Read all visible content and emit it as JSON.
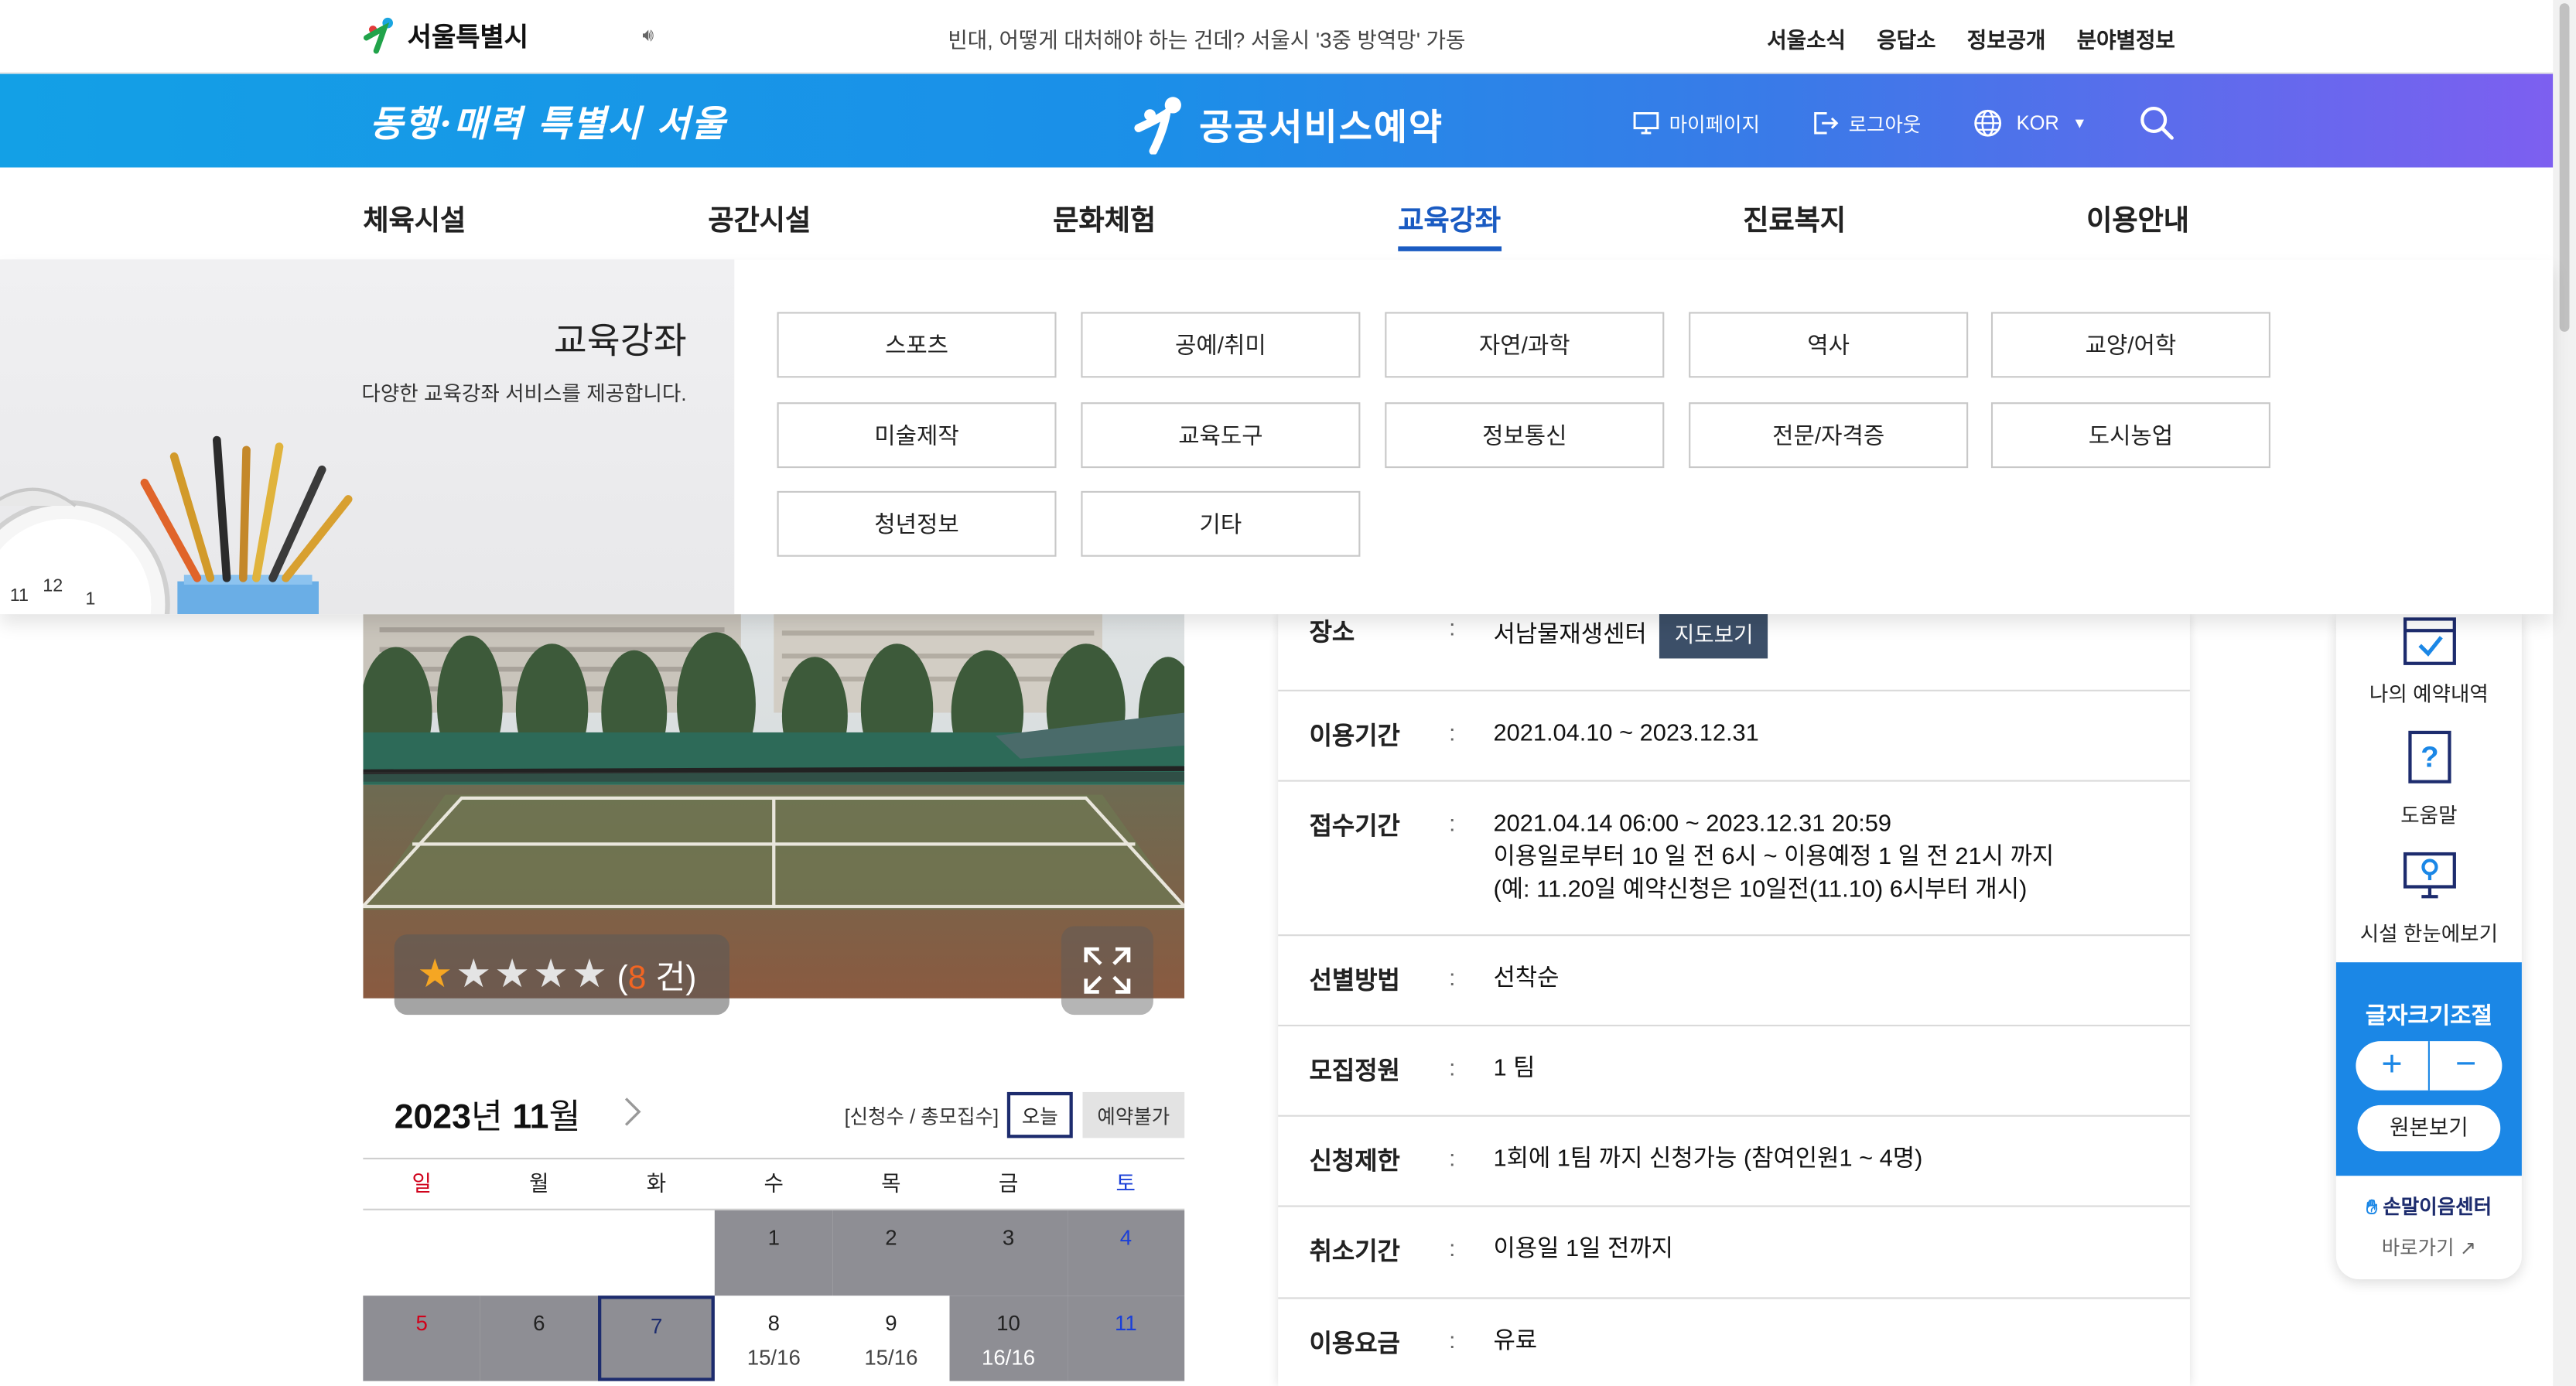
{
  "topbar": {
    "logo_text": "서울특별시",
    "ticker": "빈대, 어떻게 대처해야 하는 건데? 서울시 '3중 방역망' 가동",
    "links": [
      "서울소식",
      "응답소",
      "정보공개",
      "분야별정보"
    ]
  },
  "header": {
    "slogan": "동행·매력 특별시 서울",
    "service_title": "공공서비스예약",
    "mypage": "마이페이지",
    "logout": "로그아웃",
    "lang": "KOR"
  },
  "nav": {
    "items": [
      "체육시설",
      "공간시설",
      "문화체험",
      "교육강좌",
      "진료복지",
      "이용안내"
    ],
    "active": "교육강좌"
  },
  "mega": {
    "title": "교육강좌",
    "desc": "다양한 교육강좌 서비스를 제공합니다.",
    "categories": [
      "스포츠",
      "공예/취미",
      "자연/과학",
      "역사",
      "교양/어학",
      "미술제작",
      "교육도구",
      "정보통신",
      "전문/자격증",
      "도시농업",
      "청년정보",
      "기타"
    ]
  },
  "rating": {
    "filled_stars": 1,
    "total_stars": 5,
    "count_open": "(",
    "count": "8",
    "count_close": " 건)"
  },
  "calendar": {
    "year": "2023",
    "year_suffix": "년 ",
    "month": "11",
    "month_suffix": "월",
    "legend": "[신청수 / 총모집수]",
    "today_btn": "오늘",
    "unavailable_btn": "예약불가",
    "weekdays": [
      "일",
      "월",
      "화",
      "수",
      "목",
      "금",
      "토"
    ],
    "week1": [
      "",
      "",
      "",
      "1",
      "2",
      "3",
      "4"
    ],
    "week2": [
      "5",
      "6",
      "7",
      "8",
      "9",
      "10",
      "11"
    ],
    "week2_counts": [
      "",
      "",
      "",
      "15/16",
      "15/16",
      "16/16",
      ""
    ]
  },
  "info": {
    "rows": [
      {
        "label": "장소",
        "value": "서남물재생센터",
        "extra": "지도보기"
      },
      {
        "label": "이용기간",
        "value": "2021.04.10 ~ 2023.12.31"
      },
      {
        "label": "접수기간",
        "value": "2021.04.14 06:00 ~ 2023.12.31 20:59",
        "line2": "이용일로부터 10 일 전 6시 ~ 이용예정 1 일 전 21시 까지",
        "line3": "(예: 11.20일 예약신청은 10일전(11.10) 6시부터 개시)"
      },
      {
        "label": "선별방법",
        "value": "선착순"
      },
      {
        "label": "모집정원",
        "value": "1 팀"
      },
      {
        "label": "신청제한",
        "value": "1회에 1팀 까지 신청가능 (참여인원1 ~ 4명)"
      },
      {
        "label": "취소기간",
        "value": "이용일 1일 전까지"
      },
      {
        "label": "이용요금",
        "value": "유료"
      }
    ],
    "colon": ":"
  },
  "quick": {
    "my_reservations": "나의 예약내역",
    "help": "도움말",
    "facility_overview": "시설 한눈에보기",
    "font_size": "글자크기조절",
    "plus": "+",
    "minus": "−",
    "original": "원본보기",
    "sign_center": "손말이음센터",
    "go": "바로가기"
  },
  "colors": {
    "brand_blue": "#1b87e6",
    "nav_active": "#1a5bc2",
    "navy": "#1d2c6e"
  }
}
